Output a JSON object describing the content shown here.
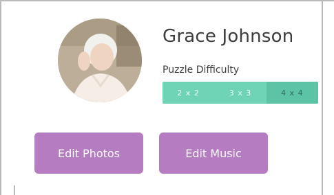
{
  "profile": {
    "name": "Grace Johnson",
    "avatar_icon": "portrait-photo"
  },
  "difficulty": {
    "label": "Puzzle Difficulty",
    "options": [
      "2 x 2",
      "3 x 3",
      "4 x 4"
    ],
    "selected": "4 x 4"
  },
  "actions": {
    "edit_photos": "Edit Photos",
    "edit_music": "Edit Music"
  },
  "colors": {
    "segment_bg": "#6fd3b6",
    "segment_active": "#5cc3a6",
    "button_bg": "#b57cc1"
  }
}
